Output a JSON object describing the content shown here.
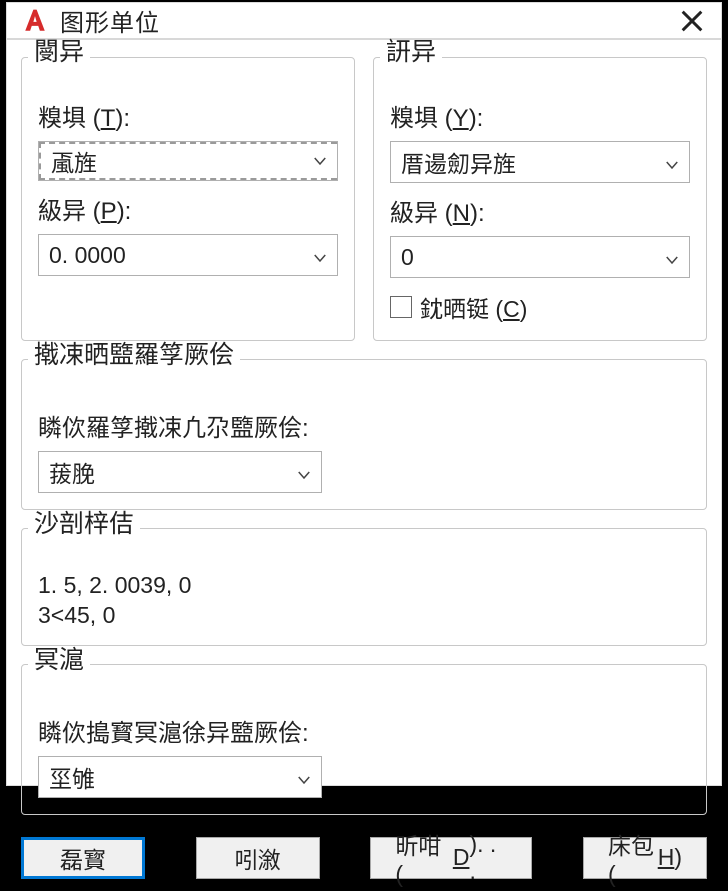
{
  "title": "图形单位",
  "left_group": {
    "title": "閿异",
    "type_label_prefix": "糗埧 (",
    "type_label_u": "T",
    "type_label_suffix": "):",
    "type_value": "颪旌",
    "precision_label_prefix": "級异 (",
    "precision_label_u": "P",
    "precision_label_suffix": "):",
    "precision_value": "0. 0000"
  },
  "right_group": {
    "title": "訮异",
    "type_label_prefix": "糗埧 (",
    "type_label_u": "Y",
    "type_label_suffix": "):",
    "type_value": "厝逿劎异旌",
    "precision_label_prefix": "級异 (",
    "precision_label_u": "N",
    "precision_label_suffix": "):",
    "precision_value": "0",
    "checkbox_prefix": "鈂晒铤 (",
    "checkbox_u": "C",
    "checkbox_suffix": ")"
  },
  "insert_group": {
    "title": "撠凁晒盬羅筟厥侩",
    "label": "瞵佽羅筟撠凁凢尕盬厥侩:",
    "value": "菝脕"
  },
  "sample_group": {
    "title": "沙剖梓佶",
    "line1": "1. 5, 2. 0039, 0",
    "line2": "3<45, 0"
  },
  "light_group": {
    "title": "冥滬",
    "label": "瞵佽搗寳冥滬徐异盬厥侩:",
    "value": "坙雊"
  },
  "buttons": {
    "ok": "磊寳",
    "cancel": "吲漵",
    "direction_prefix": "昕咁 (",
    "direction_u": "D",
    "direction_suffix": "). . .",
    "help_prefix": "床包 (",
    "help_u": "H",
    "help_suffix": ")"
  }
}
